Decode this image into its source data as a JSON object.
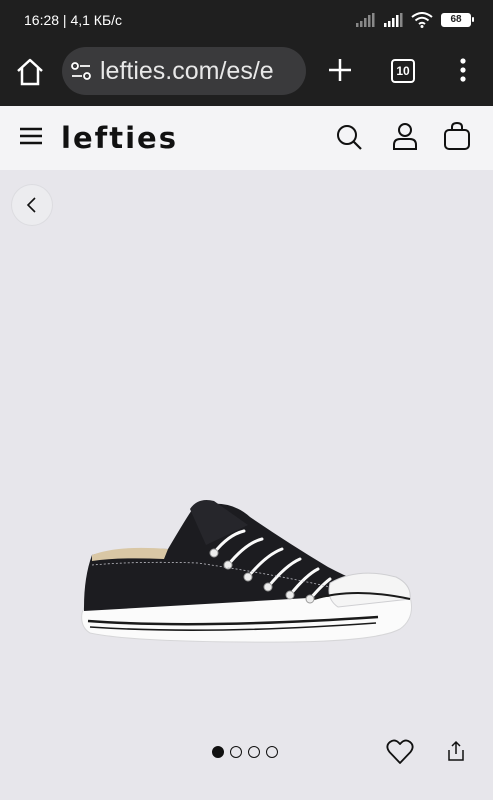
{
  "status_bar": {
    "time_network": "16:28 | 4,1 КБ/с",
    "battery": "68",
    "icons": [
      "signal-icon",
      "signal-icon",
      "wifi-icon",
      "battery-icon"
    ]
  },
  "browser": {
    "url": "lefties.com/es/e",
    "tab_count": "10",
    "icons": [
      "home-icon",
      "site-settings-icon",
      "plus-icon",
      "tab-switcher-icon",
      "more-vertical-icon"
    ]
  },
  "site_header": {
    "logo": "lefties",
    "icons": [
      "hamburger-menu-icon",
      "search-icon",
      "account-icon",
      "shopping-bag-icon"
    ]
  },
  "product": {
    "image_alt": "black low-top canvas sneaker",
    "carousel": {
      "total": 4,
      "active": 1
    },
    "icons": [
      "chevron-left-icon",
      "heart-icon",
      "share-icon"
    ]
  },
  "colors": {
    "status_bg": "#1f1f1f",
    "url_pill": "#3a3a3c",
    "header_bg": "#f4f4f6",
    "product_bg": "#e7e6eb"
  }
}
